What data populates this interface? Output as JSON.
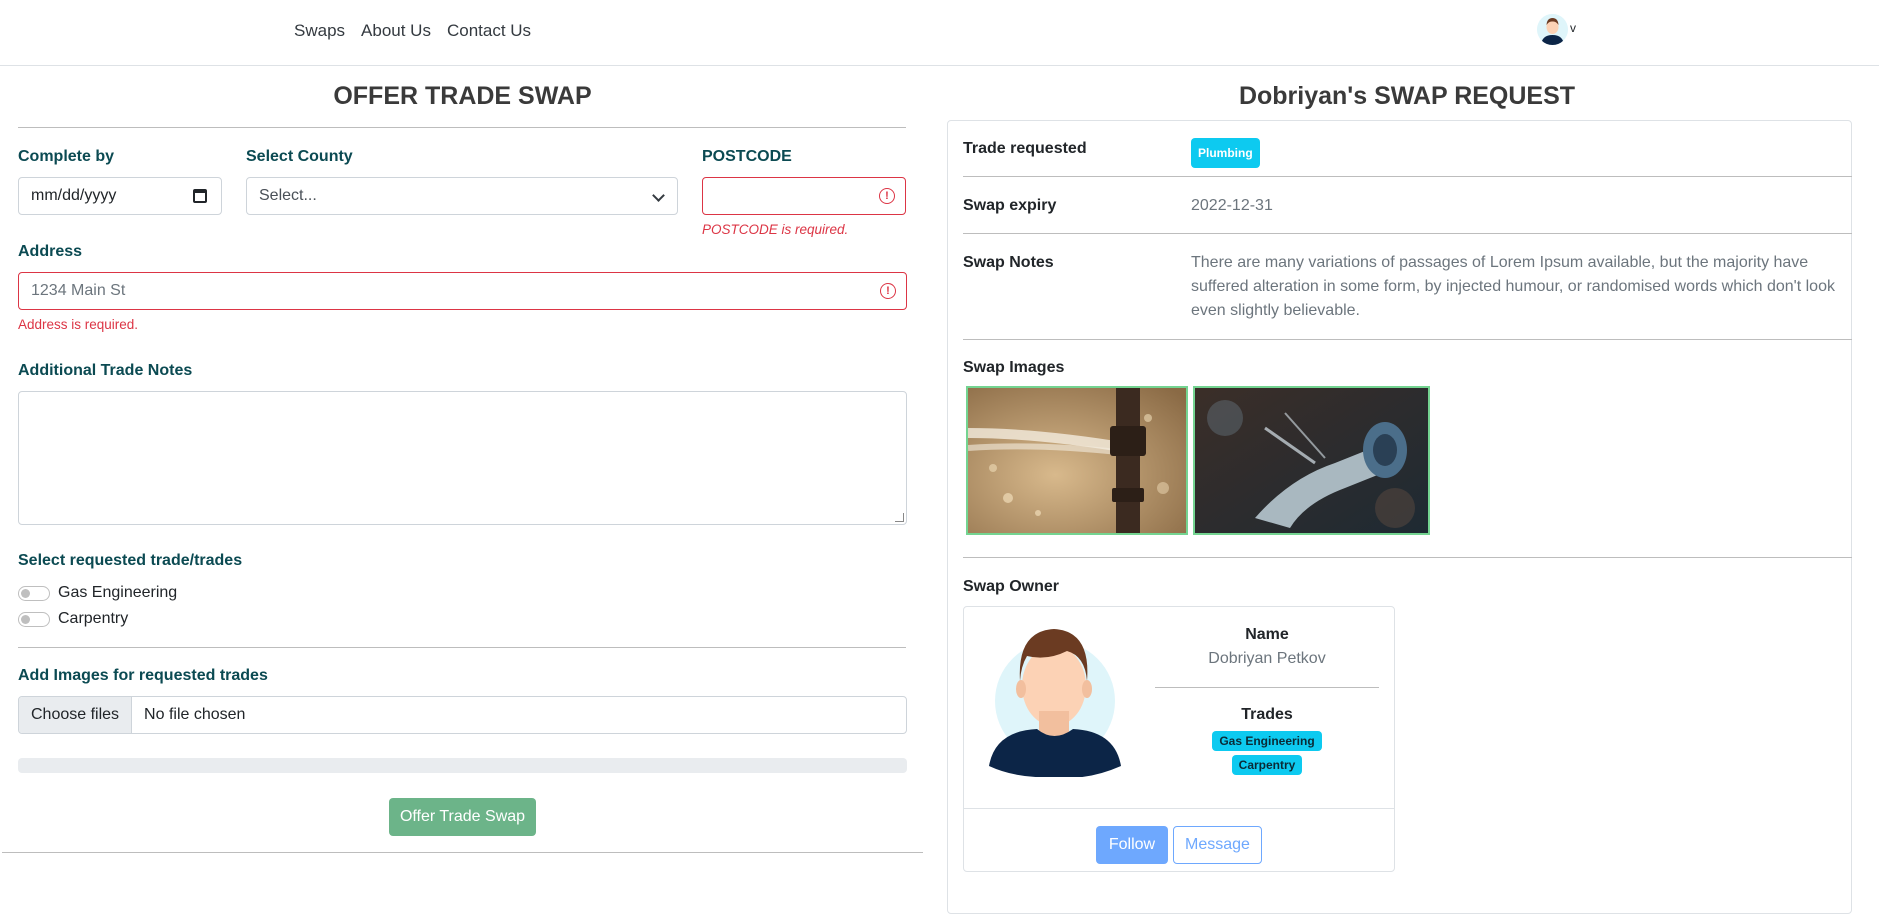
{
  "nav": {
    "links": [
      "Swaps",
      "About Us",
      "Contact Us"
    ],
    "user_caret": "v"
  },
  "offer_form": {
    "title": "OFFER TRADE SWAP",
    "complete_by": {
      "label": "Complete by",
      "placeholder": "mm/dd/yyyy"
    },
    "county": {
      "label": "Select County",
      "selected": "Select..."
    },
    "postcode": {
      "label": "POSTCODE",
      "value": "",
      "error": "POSTCODE is required."
    },
    "address": {
      "label": "Address",
      "placeholder": "1234 Main St",
      "error": "Address is required."
    },
    "notes": {
      "label": "Additional Trade Notes",
      "value": ""
    },
    "trades": {
      "label": "Select requested trade/trades",
      "options": [
        {
          "label": "Gas Engineering",
          "checked": false
        },
        {
          "label": "Carpentry",
          "checked": false
        }
      ]
    },
    "images": {
      "label": "Add Images for requested trades",
      "button": "Choose files",
      "status": "No file chosen"
    },
    "progress_percent": 0,
    "submit_label": "Offer Trade Swap"
  },
  "swap_request": {
    "title": "Dobriyan's SWAP REQUEST",
    "trade_requested_label": "Trade requested",
    "trade_requested_badge": "Plumbing",
    "expiry_label": "Swap expiry",
    "expiry_value": "2022-12-31",
    "notes_label": "Swap Notes",
    "notes_value": "There are many variations of passages of Lorem Ipsum available, but the majority have suffered alteration in some form, by injected humour, or randomised words which don't look even slightly believable.",
    "images_label": "Swap Images",
    "owner_label": "Swap Owner",
    "owner": {
      "name_label": "Name",
      "name": "Dobriyan Petkov",
      "trades_label": "Trades",
      "trades": [
        "Gas Engineering",
        "Carpentry"
      ],
      "follow_label": "Follow",
      "message_label": "Message"
    }
  },
  "colors": {
    "label_teal": "#0b4a52",
    "error_red": "#dc3545",
    "badge_cyan": "#0dcaf0",
    "submit_green": "#6cb489",
    "primary_blue": "#6ea8fe",
    "image_border": "#74d491"
  }
}
